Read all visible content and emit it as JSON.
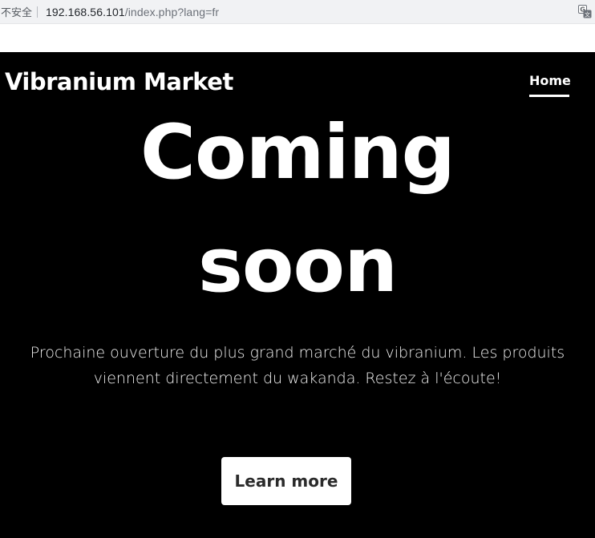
{
  "browser": {
    "security_label": "不安全",
    "url_host": "192.168.56.101",
    "url_path": "/index.php?lang=fr",
    "translate_icon": "translate-icon"
  },
  "site": {
    "brand": "Vibranium Market",
    "nav": [
      {
        "label": "Home",
        "active": true
      }
    ]
  },
  "hero": {
    "title_line1": "Coming",
    "title_line2": "soon",
    "text": "Prochaine ouverture du plus grand marché du vibranium. Les produits viennent directement du wakanda. Restez à l'écoute!",
    "cta_label": "Learn more"
  },
  "colors": {
    "page_background": "#000000",
    "text": "#ffffff",
    "button_background": "#ffffff",
    "button_text": "#2b2b2b"
  }
}
